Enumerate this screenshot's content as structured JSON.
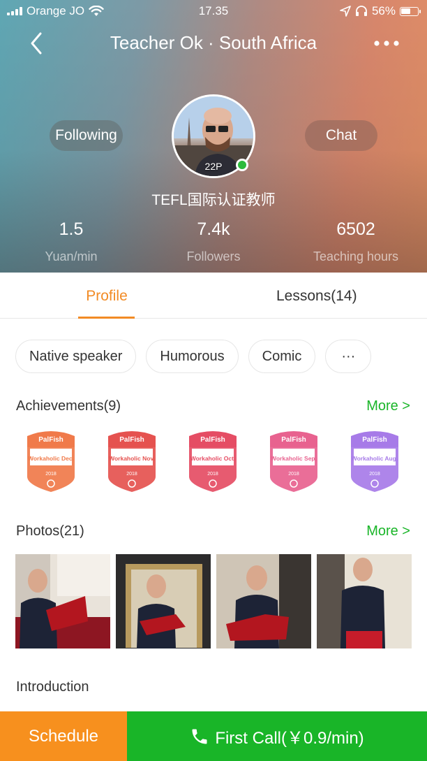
{
  "status_bar": {
    "carrier": "Orange JO",
    "time": "17.35",
    "battery": "56%",
    "icons": [
      "signal-icon",
      "wifi-icon",
      "location-icon",
      "headphones-icon",
      "battery-icon"
    ]
  },
  "header": {
    "title": "Teacher Ok · South Africa",
    "back_icon": "chevron-left-icon",
    "more_icon": "more-dots-icon",
    "following_label": "Following",
    "chat_label": "Chat",
    "avatar_level": "22P",
    "certification": "TEFL国际认证教师"
  },
  "stats": [
    {
      "value": "1.5",
      "label": "Yuan/min"
    },
    {
      "value": "7.4k",
      "label": "Followers"
    },
    {
      "value": "6502",
      "label": "Teaching hours"
    }
  ],
  "tabs": [
    {
      "label": "Profile",
      "active": true
    },
    {
      "label": "Lessons(14)",
      "active": false
    }
  ],
  "tags": [
    "Native speaker",
    "Humorous",
    "Comic",
    "···"
  ],
  "achievements": {
    "title": "Achievements(9)",
    "more_label": "More >",
    "badges": [
      {
        "brand": "PalFish",
        "title": "Workaholic Dec.",
        "year": "2018",
        "color": "#f07a4a"
      },
      {
        "brand": "PalFish",
        "title": "Workaholic Nov.",
        "year": "2018",
        "color": "#e5524f"
      },
      {
        "brand": "PalFish",
        "title": "Workaholic Oct.",
        "year": "2018",
        "color": "#e54d64"
      },
      {
        "brand": "PalFish",
        "title": "Workaholic Sep.",
        "year": "2018",
        "color": "#e8628f"
      },
      {
        "brand": "PalFish",
        "title": "Workaholic Aug.",
        "year": "2018",
        "color": "#a77be8"
      }
    ]
  },
  "photos": {
    "title": "Photos(21)",
    "more_label": "More >",
    "count_shown": 4
  },
  "introduction": {
    "title": "Introduction"
  },
  "bottom_bar": {
    "schedule_label": "Schedule",
    "call_label": "First Call(￥0.9/min)",
    "call_icon": "phone-icon"
  },
  "colors": {
    "accent_orange": "#f28b25",
    "green": "#19b528",
    "online_dot": "#2dbb3c"
  }
}
